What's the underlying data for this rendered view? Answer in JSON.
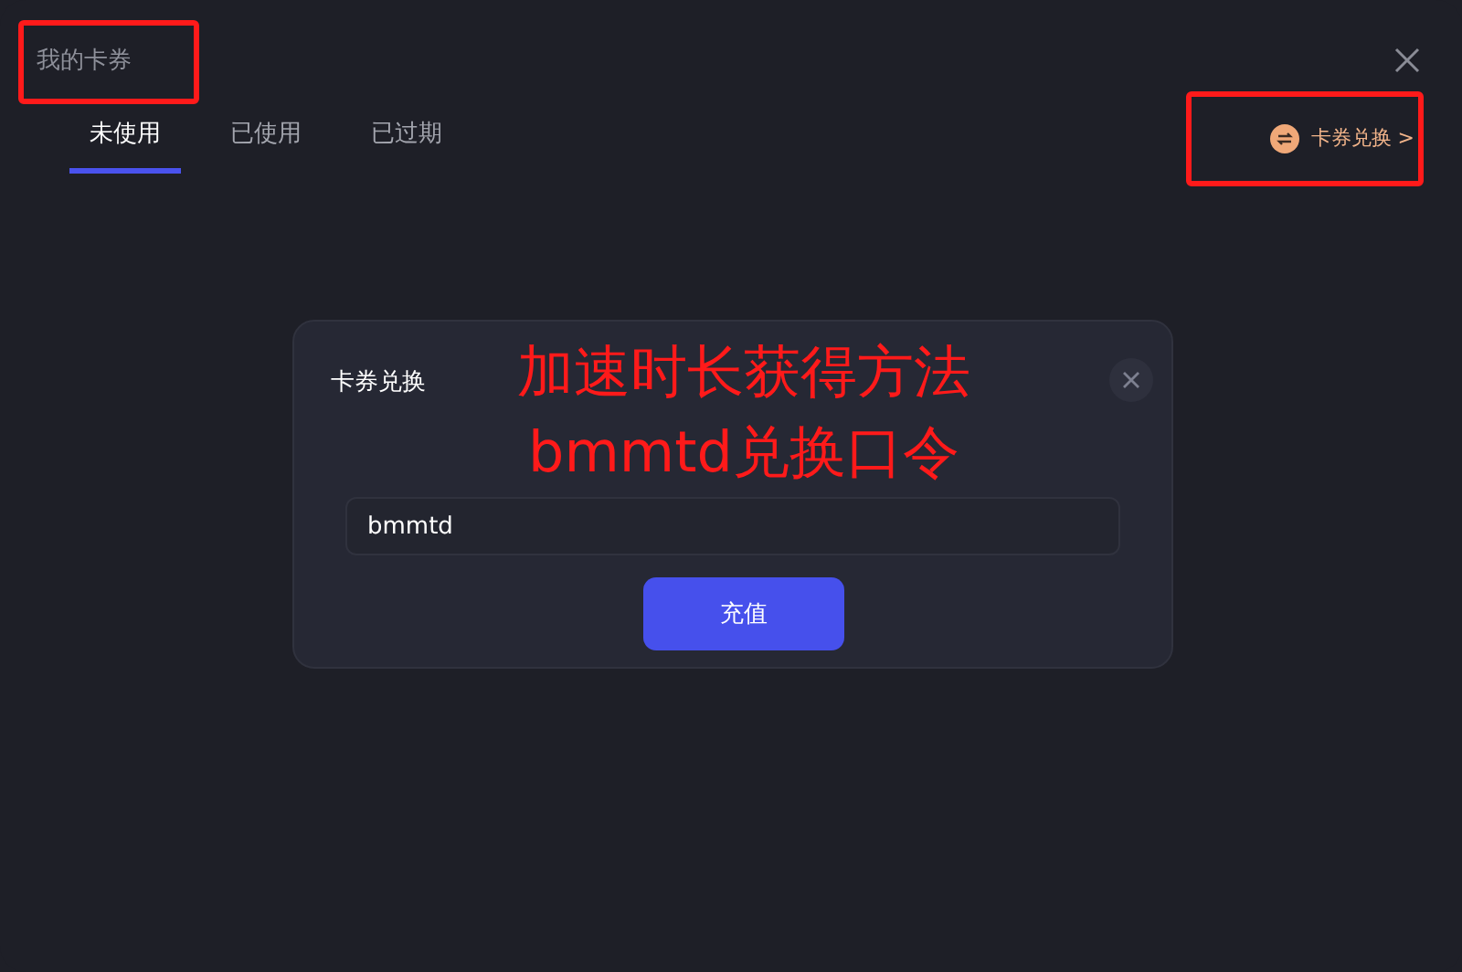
{
  "window": {
    "title": "我的卡券"
  },
  "tabs": [
    {
      "label": "未使用",
      "selected": true
    },
    {
      "label": "已使用",
      "selected": false
    },
    {
      "label": "已过期",
      "selected": false
    }
  ],
  "redeem_link": {
    "label": "卡券兑换 >"
  },
  "dialog": {
    "title": "卡券兑换",
    "input": {
      "value": "bmmtd"
    },
    "button": "充值"
  },
  "annotation_text": [
    "加速时长获得方法",
    "bmmtd兑换口令"
  ]
}
